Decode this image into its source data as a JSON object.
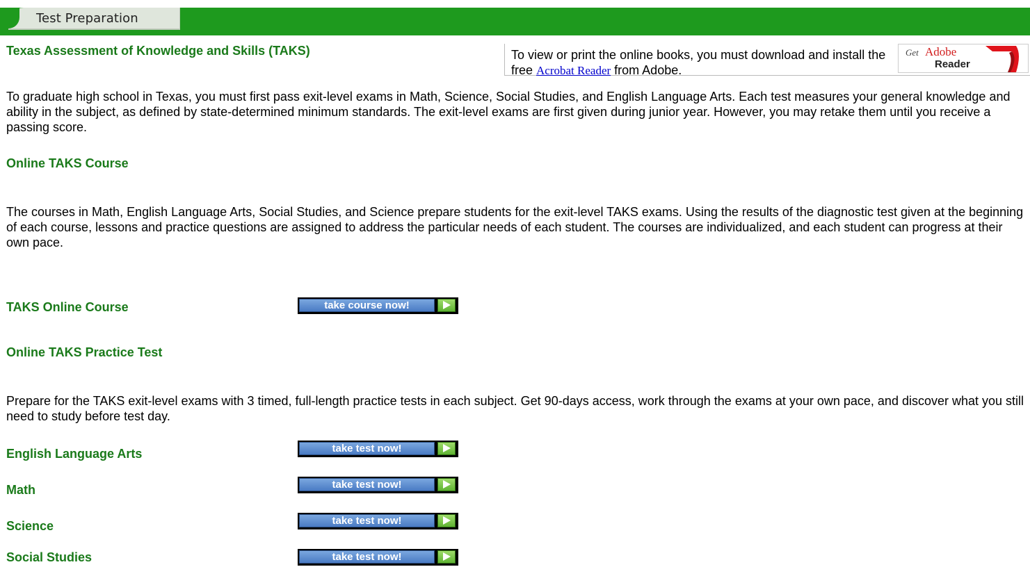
{
  "banner": {
    "title": "Test Preparation"
  },
  "taks": {
    "heading": "Texas Assessment of Knowledge and Skills (TAKS)"
  },
  "adobe": {
    "text_before": "To view or print the online books, you must download and install the free ",
    "link": "Acrobat Reader",
    "text_after": " from Adobe.",
    "badge_get": "Get",
    "badge_adobe": "Adobe",
    "badge_reader": "Reader"
  },
  "intro": {
    "paragraph": "To graduate high school in Texas, you must first pass exit-level exams in Math, Science, Social Studies, and English Language Arts. Each test measures your general knowledge and ability in the subject, as defined by state-determined minimum standards. The exit-level exams are first given during junior year. However, you may retake them until you receive a passing score."
  },
  "course": {
    "heading": "Online TAKS Course",
    "paragraph": "The courses in Math, English Language Arts, Social Studies, and Science prepare students for the exit-level TAKS exams. Using the results of the diagnostic test given at the beginning of each course, lessons and practice questions are assigned to address the particular needs of each student. The courses are individualized, and each student can progress at their own pace.",
    "item_label": "TAKS Online Course",
    "button_label": "take course now!"
  },
  "practice": {
    "heading": "Online TAKS Practice Test",
    "paragraph": "Prepare for the TAKS exit-level exams with 3 timed, full-length practice tests in each subject. Get 90-days access, work through the exams at your own pace, and discover what you still need to study before test day.",
    "items": [
      {
        "label": "English Language Arts",
        "button": "take test now!"
      },
      {
        "label": "Math",
        "button": "take test now!"
      },
      {
        "label": "Science",
        "button": "take test now!"
      },
      {
        "label": "Social Studies",
        "button": "take test now!"
      }
    ]
  },
  "colors": {
    "banner_green": "#1e9a1e",
    "heading_green": "#1a7a1a",
    "link_blue": "#0000cc",
    "button_blue": "#4a7bc4",
    "arrow_green": "#5fb333"
  }
}
